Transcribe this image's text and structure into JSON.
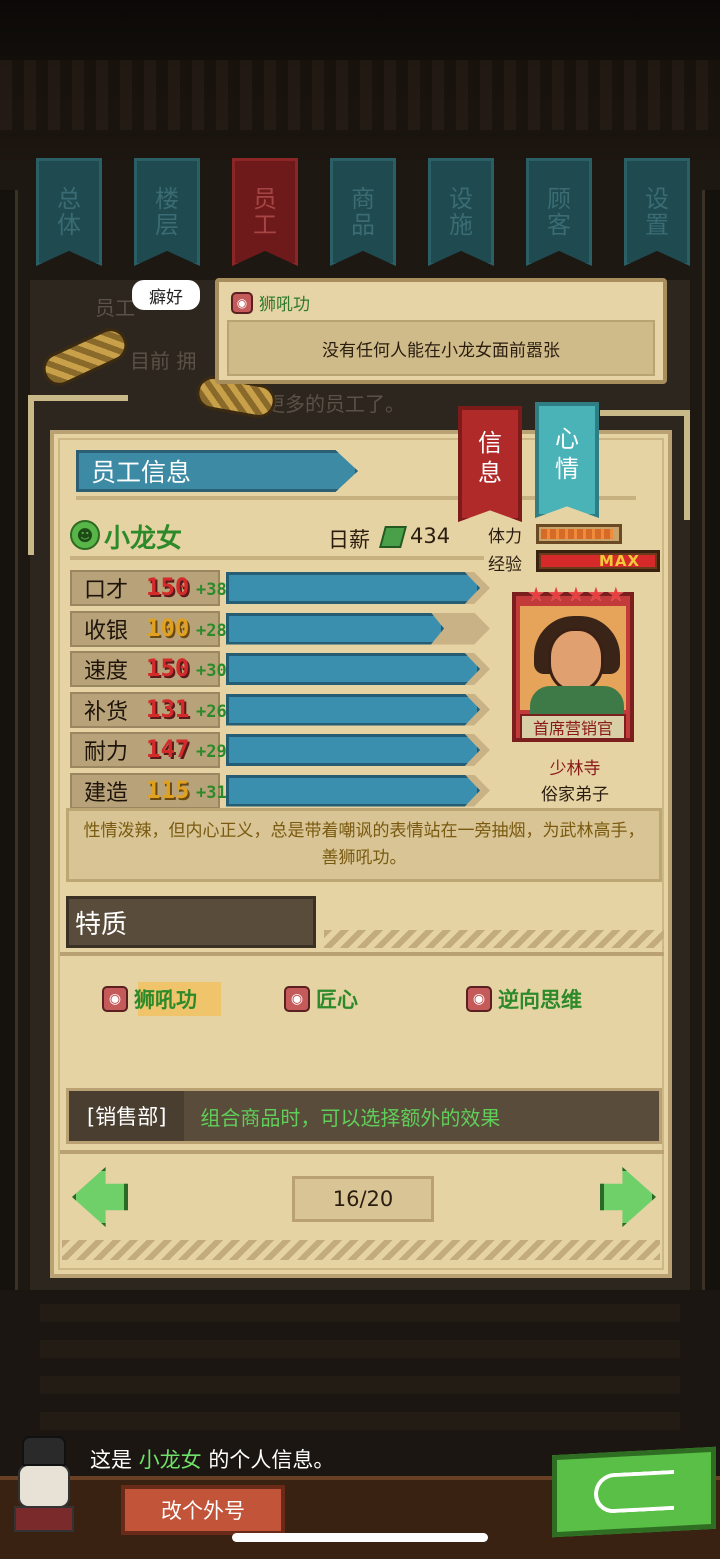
{
  "top_tabs": [
    {
      "label_1": "总",
      "label_2": "体",
      "active": false
    },
    {
      "label_1": "楼",
      "label_2": "层",
      "active": false
    },
    {
      "label_1": "员",
      "label_2": "工",
      "active": true
    },
    {
      "label_1": "商",
      "label_2": "品",
      "active": false
    },
    {
      "label_1": "设",
      "label_2": "施",
      "active": false
    },
    {
      "label_1": "顾",
      "label_2": "客",
      "active": false
    },
    {
      "label_1": "设",
      "label_2": "置",
      "active": false
    }
  ],
  "background_text": {
    "line1": "员工",
    "line2": "目前 拥",
    "line3": "更多的员工了。"
  },
  "hobby": {
    "badge": "癖好",
    "trait_name": "狮吼功",
    "description": "没有任何人能在小龙女面前嚣张"
  },
  "panel": {
    "header": "员工信息",
    "side_tab_info": {
      "char1": "信",
      "char2": "息"
    },
    "side_tab_mood": {
      "char1": "心",
      "char2": "情"
    },
    "employee_name": "小龙女",
    "wage_label": "日薪",
    "wage_value": "434",
    "energy_label": "体力",
    "energy_level": 0.95,
    "exp_label": "经验",
    "exp_max": "MAX",
    "stats": [
      {
        "label": "口才",
        "base": "150",
        "bonus": "+38",
        "fill": 1.0
      },
      {
        "label": "收银",
        "base": "100",
        "bonus": "+28",
        "fill": 0.86
      },
      {
        "label": "速度",
        "base": "150",
        "bonus": "+30",
        "fill": 1.0
      },
      {
        "label": "补货",
        "base": "131",
        "bonus": "+26",
        "fill": 1.0
      },
      {
        "label": "耐力",
        "base": "147",
        "bonus": "+29",
        "fill": 1.0
      },
      {
        "label": "建造",
        "base": "115",
        "bonus": "+31",
        "fill": 1.0
      }
    ],
    "portrait": {
      "stars": "★★★★★",
      "role": "首席营销官",
      "sect": "少林寺",
      "rank": "俗家弟子"
    },
    "description": "性情泼辣，但内心正义，总是带着嘲讽的表情站在一旁抽烟，为武林高手，善狮吼功。",
    "traits_header": "特质",
    "traits": [
      "狮吼功",
      "匠心",
      "逆向思维"
    ],
    "department": {
      "name": "[销售部]",
      "effect": "组合商品时，可以选择额外的效果"
    },
    "page_indicator": "16/20"
  },
  "footer": {
    "dialog_prefix": "这是",
    "dialog_name": "小龙女",
    "dialog_suffix": "的个人信息。",
    "rename_button": "改个外号"
  },
  "colors": {
    "panel_bg": "#e6d3a3",
    "stat_bar": "#3b8fae",
    "name_green": "#2d8a2a",
    "active_tab": "#6e1a1a",
    "inactive_tab": "#1e4a50"
  }
}
